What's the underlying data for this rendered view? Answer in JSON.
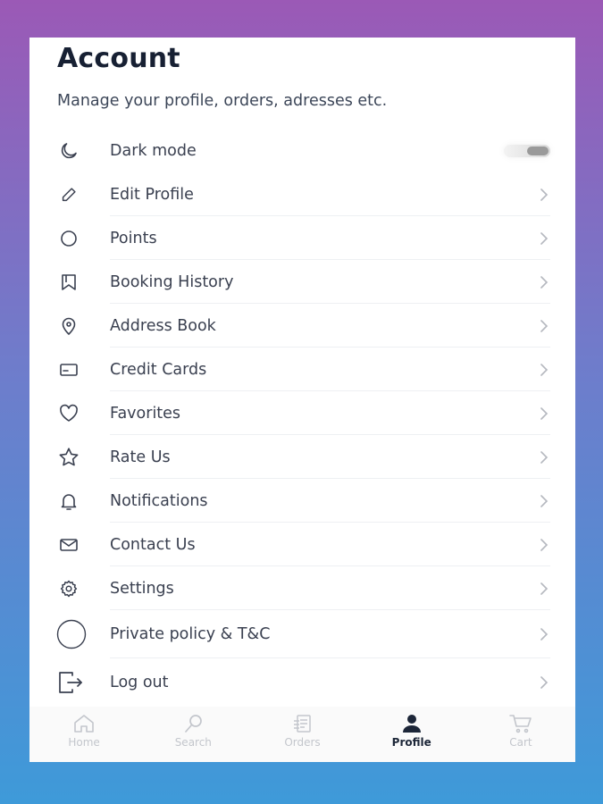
{
  "header": {
    "title": "Account",
    "subtitle": "Manage your profile, orders, adresses etc."
  },
  "menu": {
    "items": [
      {
        "label": "Dark mode",
        "icon": "moon-icon"
      },
      {
        "label": "Edit Profile",
        "icon": "pencil-icon"
      },
      {
        "label": "Points",
        "icon": "circle-icon"
      },
      {
        "label": "Booking History",
        "icon": "book-icon"
      },
      {
        "label": "Address Book",
        "icon": "location-pin-icon"
      },
      {
        "label": "Credit Cards",
        "icon": "credit-card-icon"
      },
      {
        "label": "Favorites",
        "icon": "heart-icon"
      },
      {
        "label": "Rate Us",
        "icon": "star-icon"
      },
      {
        "label": "Notifications",
        "icon": "bell-icon"
      },
      {
        "label": "Contact Us",
        "icon": "mail-icon"
      },
      {
        "label": "Settings",
        "icon": "gear-icon"
      },
      {
        "label": "Private policy & T&C",
        "icon": "circle-outline-icon"
      },
      {
        "label": "Log out",
        "icon": "logout-icon"
      }
    ],
    "dark_mode_enabled": false
  },
  "tabbar": {
    "tabs": [
      {
        "label": "Home",
        "icon": "home-icon"
      },
      {
        "label": "Search",
        "icon": "search-icon"
      },
      {
        "label": "Orders",
        "icon": "orders-icon"
      },
      {
        "label": "Profile",
        "icon": "profile-icon",
        "active": true
      },
      {
        "label": "Cart",
        "icon": "cart-icon"
      }
    ]
  },
  "colors": {
    "title": "#172033",
    "text": "#3a4050",
    "icon": "#3a4050",
    "chevron": "#b5b8bf",
    "inactive_tab": "#c3c6cc",
    "active_tab": "#1c2638"
  }
}
